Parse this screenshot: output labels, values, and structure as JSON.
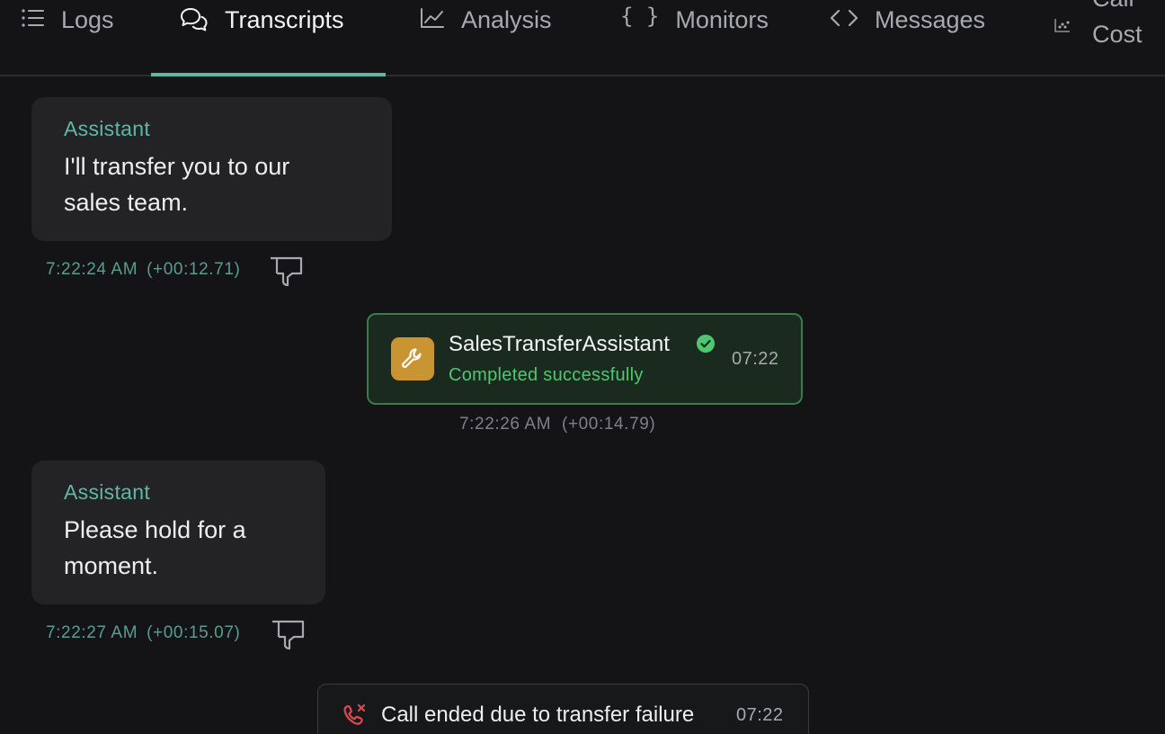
{
  "tabs": [
    {
      "id": "logs",
      "label": "Logs",
      "icon": "list-icon"
    },
    {
      "id": "transcripts",
      "label": "Transcripts",
      "icon": "chat-bubbles-icon",
      "active": true
    },
    {
      "id": "analysis",
      "label": "Analysis",
      "icon": "line-chart-icon"
    },
    {
      "id": "monitors",
      "label": "Monitors",
      "icon": "braces-icon"
    },
    {
      "id": "messages",
      "label": "Messages",
      "icon": "code-brackets-icon"
    },
    {
      "id": "call-cost",
      "label_line1": "Call",
      "label_line2": "Cost",
      "icon": "scatter-chart-icon"
    }
  ],
  "transcript": {
    "messages": [
      {
        "role": "Assistant",
        "text_line1": "I'll transfer you to our",
        "text_line2": "sales team.",
        "timestamp": "7:22:24 AM",
        "offset": "(+00:12.71)"
      },
      {
        "role": "Assistant",
        "text_line1": "Please hold for a",
        "text_line2": "moment.",
        "timestamp": "7:22:27 AM",
        "offset": "(+00:15.07)"
      }
    ],
    "tool_call": {
      "name": "SalesTransferAssistant",
      "status": "Completed successfully",
      "time": "07:22",
      "timestamp": "7:22:26 AM",
      "offset": "(+00:14.79)"
    },
    "call_end": {
      "text": "Call ended due to transfer failure",
      "time": "07:22"
    }
  },
  "colors": {
    "background": "#141416",
    "accent": "#5fb7a6",
    "success": "#4ec770",
    "tool_icon_bg": "#c99432",
    "error": "#e0484f"
  }
}
